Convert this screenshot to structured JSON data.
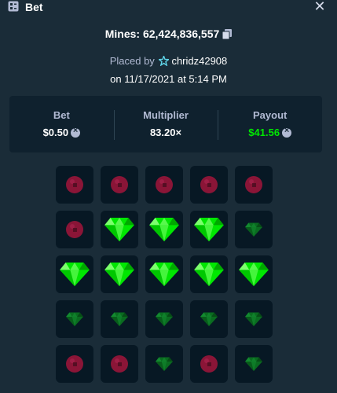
{
  "header": {
    "title": "Bet",
    "icon": "bet-slip-icon",
    "close_icon": "close-icon"
  },
  "game": {
    "mines_label": "Mines: 62,424,836,557",
    "placed_by_prefix": "Placed by",
    "username": "chridz42908",
    "date_prefix": "on",
    "date": "11/17/2021 at 5:14 PM"
  },
  "stats": {
    "bet_label": "Bet",
    "bet_value": "$0.50",
    "multiplier_label": "Multiplier",
    "multiplier_value": "83.20×",
    "payout_label": "Payout",
    "payout_value": "$41.56"
  },
  "colors": {
    "background": "#1a2c38",
    "panel": "#0f212e",
    "tile": "#071824",
    "gem_revealed": "#00e701",
    "gem_dim": "#0a6b20",
    "mine": "#8a1537",
    "payout": "#00e701"
  },
  "board": {
    "rows": [
      [
        "mine",
        "mine",
        "mine",
        "mine",
        "mine"
      ],
      [
        "mine",
        "gem-revealed",
        "gem-revealed",
        "gem-revealed",
        "gem"
      ],
      [
        "gem-revealed",
        "gem-revealed",
        "gem-revealed",
        "gem-revealed",
        "gem-revealed"
      ],
      [
        "gem",
        "gem",
        "gem",
        "gem",
        "gem"
      ],
      [
        "mine",
        "mine",
        "gem",
        "mine",
        "gem"
      ]
    ]
  }
}
